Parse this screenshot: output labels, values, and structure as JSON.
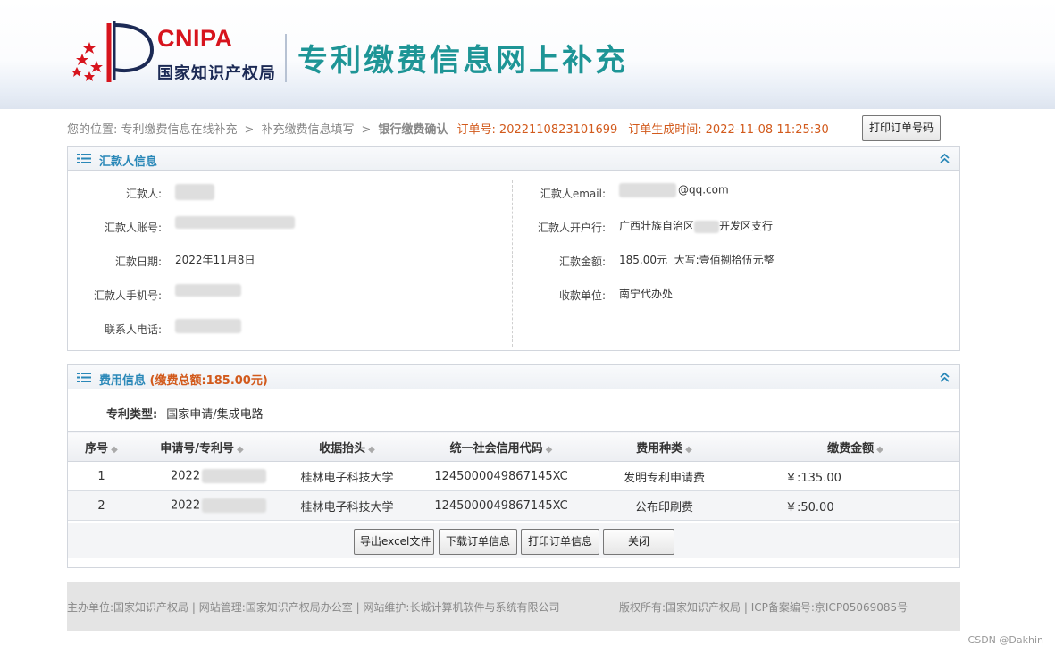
{
  "header": {
    "logo_en": "CNIPA",
    "logo_cn": "国家知识产权局",
    "site_title": "专利缴费信息网上补充"
  },
  "breadcrumb": {
    "prefix": "您的位置:",
    "step1": "专利缴费信息在线补充",
    "sep": ">",
    "step2": "补充缴费信息填写",
    "current": "银行缴费确认",
    "order_label": "订单号:",
    "order_no": "2022110823101699",
    "created_label": "订单生成时间:",
    "created_time": "2022-11-08 11:25:30",
    "print_order_button": "打印订单号码"
  },
  "remitter_panel": {
    "title": "汇款人信息",
    "fields": {
      "name_label": "汇款人:",
      "account_label": "汇款人账号:",
      "date_label": "汇款日期:",
      "date_value": "2022年11月8日",
      "phone_label": "汇款人手机号:",
      "contact_label": "联系人电话:",
      "email_label": "汇款人email:",
      "email_value": "@qq.com",
      "bank_label": "汇款人开户行:",
      "bank_value_prefix": "广西壮族自治区",
      "bank_value_suffix": "开发区支行",
      "amount_label": "汇款金额:",
      "amount_value": "185.00元  大写:壹佰捌拾伍元整",
      "payee_label": "收款单位:",
      "payee_value": "南宁代办处"
    }
  },
  "fee_panel": {
    "title": "费用信息",
    "total_text": "(缴费总额:185.00元)",
    "patent_type_label": "专利类型:",
    "patent_type_value": "国家申请/集成电路",
    "columns": [
      "序号",
      "申请号/专利号",
      "收据抬头",
      "统一社会信用代码",
      "费用种类",
      "缴费金额"
    ],
    "rows": [
      {
        "idx": "1",
        "app_no": "2022",
        "payee": "桂林电子科技大学",
        "code": "1245000049867145XC",
        "kind": "发明专利申请费",
        "amount": "￥:135.00"
      },
      {
        "idx": "2",
        "app_no": "2022",
        "payee": "桂林电子科技大学",
        "code": "1245000049867145XC",
        "kind": "公布印刷费",
        "amount": "￥:50.00"
      }
    ],
    "buttons": {
      "export": "导出excel文件",
      "download": "下载订单信息",
      "print": "打印订单信息",
      "close": "关闭"
    }
  },
  "footer": {
    "left": "主办单位:国家知识产权局 | 网站管理:国家知识产权局办公室 | 网站维护:长城计算机软件与系统有限公司",
    "right": "版权所有:国家知识产权局 | ICP备案编号:京ICP05069085号"
  },
  "watermark": "CSDN @Dakhin",
  "colors": {
    "brand_red": "#d7141d",
    "title_teal": "#1e9596",
    "panel_title_blue": "#2a88b8",
    "highlight_orange": "#d25a1c"
  }
}
